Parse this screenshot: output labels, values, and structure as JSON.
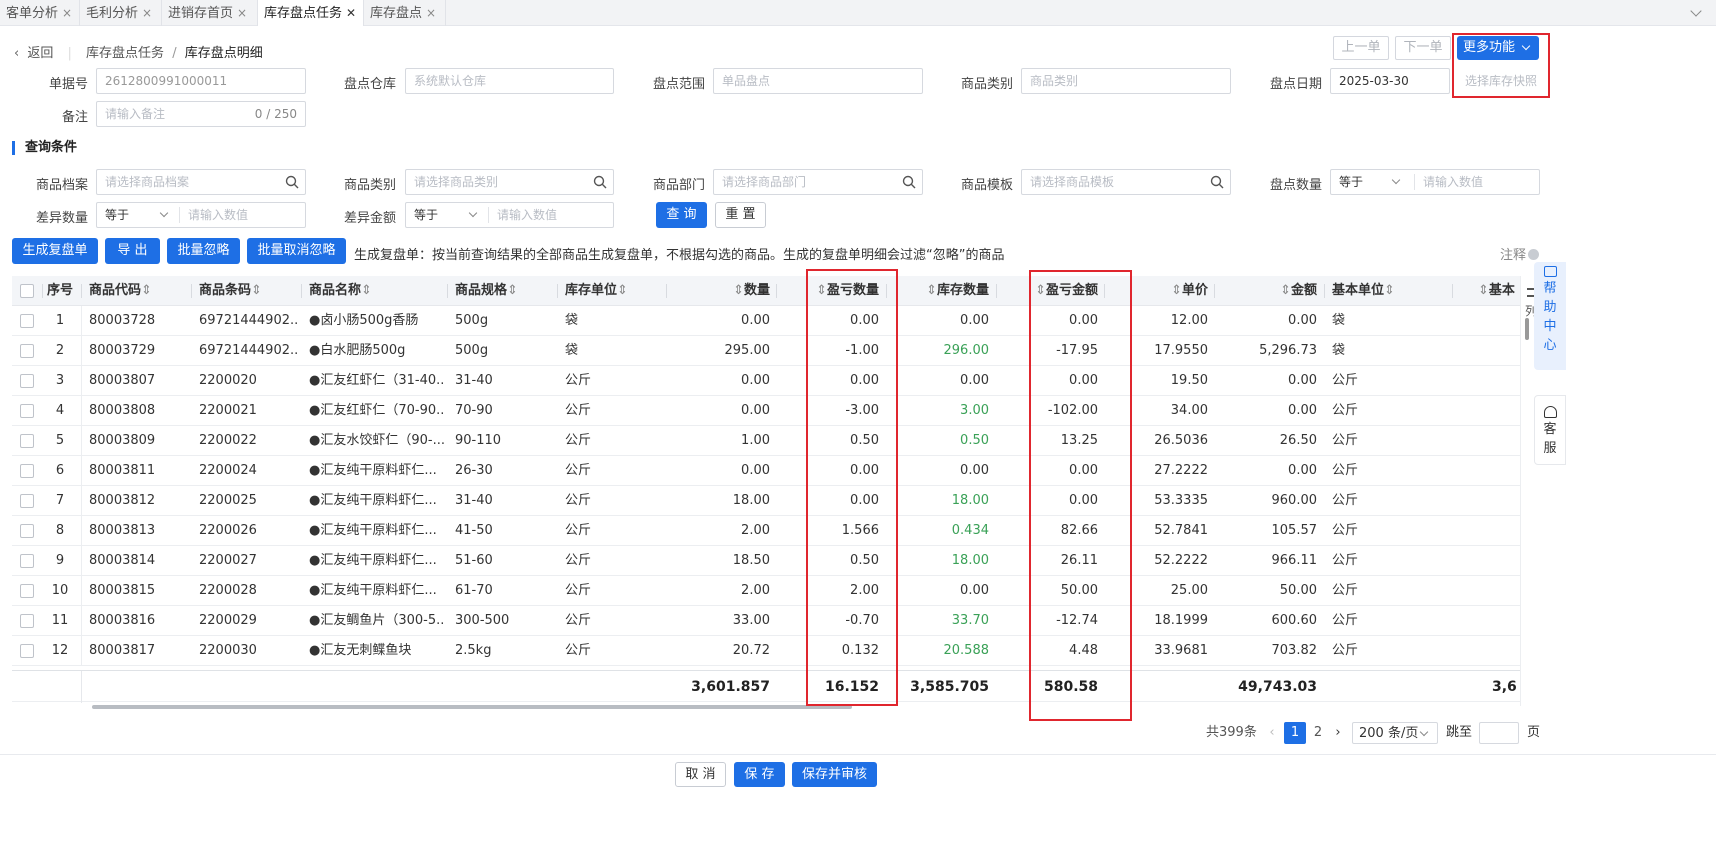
{
  "tabs": [
    {
      "label": "客单分析"
    },
    {
      "label": "毛利分析"
    },
    {
      "label": "进销存首页"
    },
    {
      "label": "库存盘点任务"
    },
    {
      "label": "库存盘点"
    }
  ],
  "tab_close": "×",
  "tab_close_active": "✕",
  "breadcrumb": {
    "back": "返回",
    "parent": "库存盘点任务",
    "sep": "/",
    "current": "库存盘点明细"
  },
  "toolbar": {
    "prev": "上一单",
    "next": "下一单",
    "more": "更多功能",
    "more_item": "选择库存快照"
  },
  "form": {
    "doc_no_label": "单据号",
    "doc_no_value": "2612800991000011",
    "warehouse_label": "盘点仓库",
    "warehouse_placeholder": "系统默认仓库",
    "scope_label": "盘点范围",
    "scope_placeholder": "单品盘点",
    "category_label": "商品类别",
    "category_placeholder": "商品类别",
    "date_label": "盘点日期",
    "date_value": "2025-03-30",
    "remark_label": "备注",
    "remark_placeholder": "请输入备注",
    "remark_count": "0 / 250"
  },
  "query": {
    "title": "查询条件",
    "goods_label": "商品档案",
    "goods_placeholder": "请选择商品档案",
    "cat_label": "商品类别",
    "cat_placeholder": "请选择商品类别",
    "dept_label": "商品部门",
    "dept_placeholder": "请选择商品部门",
    "tpl_label": "商品模板",
    "tpl_placeholder": "请选择商品模板",
    "qty_label": "盘点数量",
    "qty_op": "等于",
    "qty_placeholder": "请输入数值",
    "diffqty_label": "差异数量",
    "diffqty_op": "等于",
    "diffqty_placeholder": "请输入数值",
    "diffamt_label": "差异金额",
    "diffamt_op": "等于",
    "diffamt_placeholder": "请输入数值",
    "search": "查 询",
    "reset": "重 置"
  },
  "actions": {
    "gen": "生成复盘单",
    "export": "导 出",
    "ignore": "批量忽略",
    "unignore": "批量取消忽略",
    "hint": "生成复盘单：按当前查询结果的全部商品生成复盘单，不根据勾选的商品。生成的复盘单明细会过滤“忽略”的商品",
    "note": "注释"
  },
  "columns": [
    "序号",
    "商品代码",
    "商品条码",
    "商品名称",
    "商品规格",
    "库存单位",
    "数量",
    "盈亏数量",
    "库存数量",
    "盈亏金额",
    "单价",
    "金额",
    "基本单位",
    "基本"
  ],
  "sort_glyph": "⇕",
  "col_setting": "列",
  "rows": [
    {
      "idx": "1",
      "code": "80003728",
      "barcode": "69721444902...",
      "name": "●卤小肠500g香肠",
      "spec": "500g",
      "unit": "袋",
      "qty": "0.00",
      "diff_qty": "0.00",
      "stock_qty": "0.00",
      "diff_amt": "0.00",
      "price": "12.00",
      "amount": "0.00",
      "base_unit": "袋",
      "stock_green": false
    },
    {
      "idx": "2",
      "code": "80003729",
      "barcode": "69721444902...",
      "name": "●白水肥肠500g",
      "spec": "500g",
      "unit": "袋",
      "qty": "295.00",
      "diff_qty": "-1.00",
      "stock_qty": "296.00",
      "diff_amt": "-17.95",
      "price": "17.9550",
      "amount": "5,296.73",
      "base_unit": "袋",
      "stock_green": true
    },
    {
      "idx": "3",
      "code": "80003807",
      "barcode": "2200020",
      "name": "●汇友红虾仁（31-40...",
      "spec": "31-40",
      "unit": "公斤",
      "qty": "0.00",
      "diff_qty": "0.00",
      "stock_qty": "0.00",
      "diff_amt": "0.00",
      "price": "19.50",
      "amount": "0.00",
      "base_unit": "公斤",
      "stock_green": false
    },
    {
      "idx": "4",
      "code": "80003808",
      "barcode": "2200021",
      "name": "●汇友红虾仁（70-90...",
      "spec": "70-90",
      "unit": "公斤",
      "qty": "0.00",
      "diff_qty": "-3.00",
      "stock_qty": "3.00",
      "diff_amt": "-102.00",
      "price": "34.00",
      "amount": "0.00",
      "base_unit": "公斤",
      "stock_green": true
    },
    {
      "idx": "5",
      "code": "80003809",
      "barcode": "2200022",
      "name": "●汇友水饺虾仁（90-...",
      "spec": "90-110",
      "unit": "公斤",
      "qty": "1.00",
      "diff_qty": "0.50",
      "stock_qty": "0.50",
      "diff_amt": "13.25",
      "price": "26.5036",
      "amount": "26.50",
      "base_unit": "公斤",
      "stock_green": true
    },
    {
      "idx": "6",
      "code": "80003811",
      "barcode": "2200024",
      "name": "●汇友纯干原料虾仁...",
      "spec": "26-30",
      "unit": "公斤",
      "qty": "0.00",
      "diff_qty": "0.00",
      "stock_qty": "0.00",
      "diff_amt": "0.00",
      "price": "27.2222",
      "amount": "0.00",
      "base_unit": "公斤",
      "stock_green": false
    },
    {
      "idx": "7",
      "code": "80003812",
      "barcode": "2200025",
      "name": "●汇友纯干原料虾仁...",
      "spec": "31-40",
      "unit": "公斤",
      "qty": "18.00",
      "diff_qty": "0.00",
      "stock_qty": "18.00",
      "diff_amt": "0.00",
      "price": "53.3335",
      "amount": "960.00",
      "base_unit": "公斤",
      "stock_green": true
    },
    {
      "idx": "8",
      "code": "80003813",
      "barcode": "2200026",
      "name": "●汇友纯干原料虾仁...",
      "spec": "41-50",
      "unit": "公斤",
      "qty": "2.00",
      "diff_qty": "1.566",
      "stock_qty": "0.434",
      "diff_amt": "82.66",
      "price": "52.7841",
      "amount": "105.57",
      "base_unit": "公斤",
      "stock_green": true
    },
    {
      "idx": "9",
      "code": "80003814",
      "barcode": "2200027",
      "name": "●汇友纯干原料虾仁...",
      "spec": "51-60",
      "unit": "公斤",
      "qty": "18.50",
      "diff_qty": "0.50",
      "stock_qty": "18.00",
      "diff_amt": "26.11",
      "price": "52.2222",
      "amount": "966.11",
      "base_unit": "公斤",
      "stock_green": true
    },
    {
      "idx": "10",
      "code": "80003815",
      "barcode": "2200028",
      "name": "●汇友纯干原料虾仁...",
      "spec": "61-70",
      "unit": "公斤",
      "qty": "2.00",
      "diff_qty": "2.00",
      "stock_qty": "0.00",
      "diff_amt": "50.00",
      "price": "25.00",
      "amount": "50.00",
      "base_unit": "公斤",
      "stock_green": false
    },
    {
      "idx": "11",
      "code": "80003816",
      "barcode": "2200029",
      "name": "●汇友鲷鱼片（300-5...",
      "spec": "300-500",
      "unit": "公斤",
      "qty": "33.00",
      "diff_qty": "-0.70",
      "stock_qty": "33.70",
      "diff_amt": "-12.74",
      "price": "18.1999",
      "amount": "600.60",
      "base_unit": "公斤",
      "stock_green": true
    },
    {
      "idx": "12",
      "code": "80003817",
      "barcode": "2200030",
      "name": "●汇友无刺鲽鱼块",
      "spec": "2.5kg",
      "unit": "公斤",
      "qty": "20.72",
      "diff_qty": "0.132",
      "stock_qty": "20.588",
      "diff_amt": "4.48",
      "price": "33.9681",
      "amount": "703.82",
      "base_unit": "公斤",
      "stock_green": true
    }
  ],
  "summary": {
    "qty": "3,601.857",
    "diff_qty": "16.152",
    "stock_qty": "3,585.705",
    "diff_amt": "580.58",
    "amount": "49,743.03",
    "extra": "3,6"
  },
  "pager": {
    "total": "共399条",
    "page1": "1",
    "page2": "2",
    "size": "200 条/页",
    "jump": "跳至",
    "page_unit": "页"
  },
  "side": {
    "help": "帮助中心",
    "service": "客服"
  },
  "footer": {
    "cancel": "取 消",
    "save": "保 存",
    "save_audit": "保存并审核"
  },
  "colors": {
    "primary": "#1e6fe5",
    "highlight": "#e0262e",
    "green": "#3aa157"
  }
}
